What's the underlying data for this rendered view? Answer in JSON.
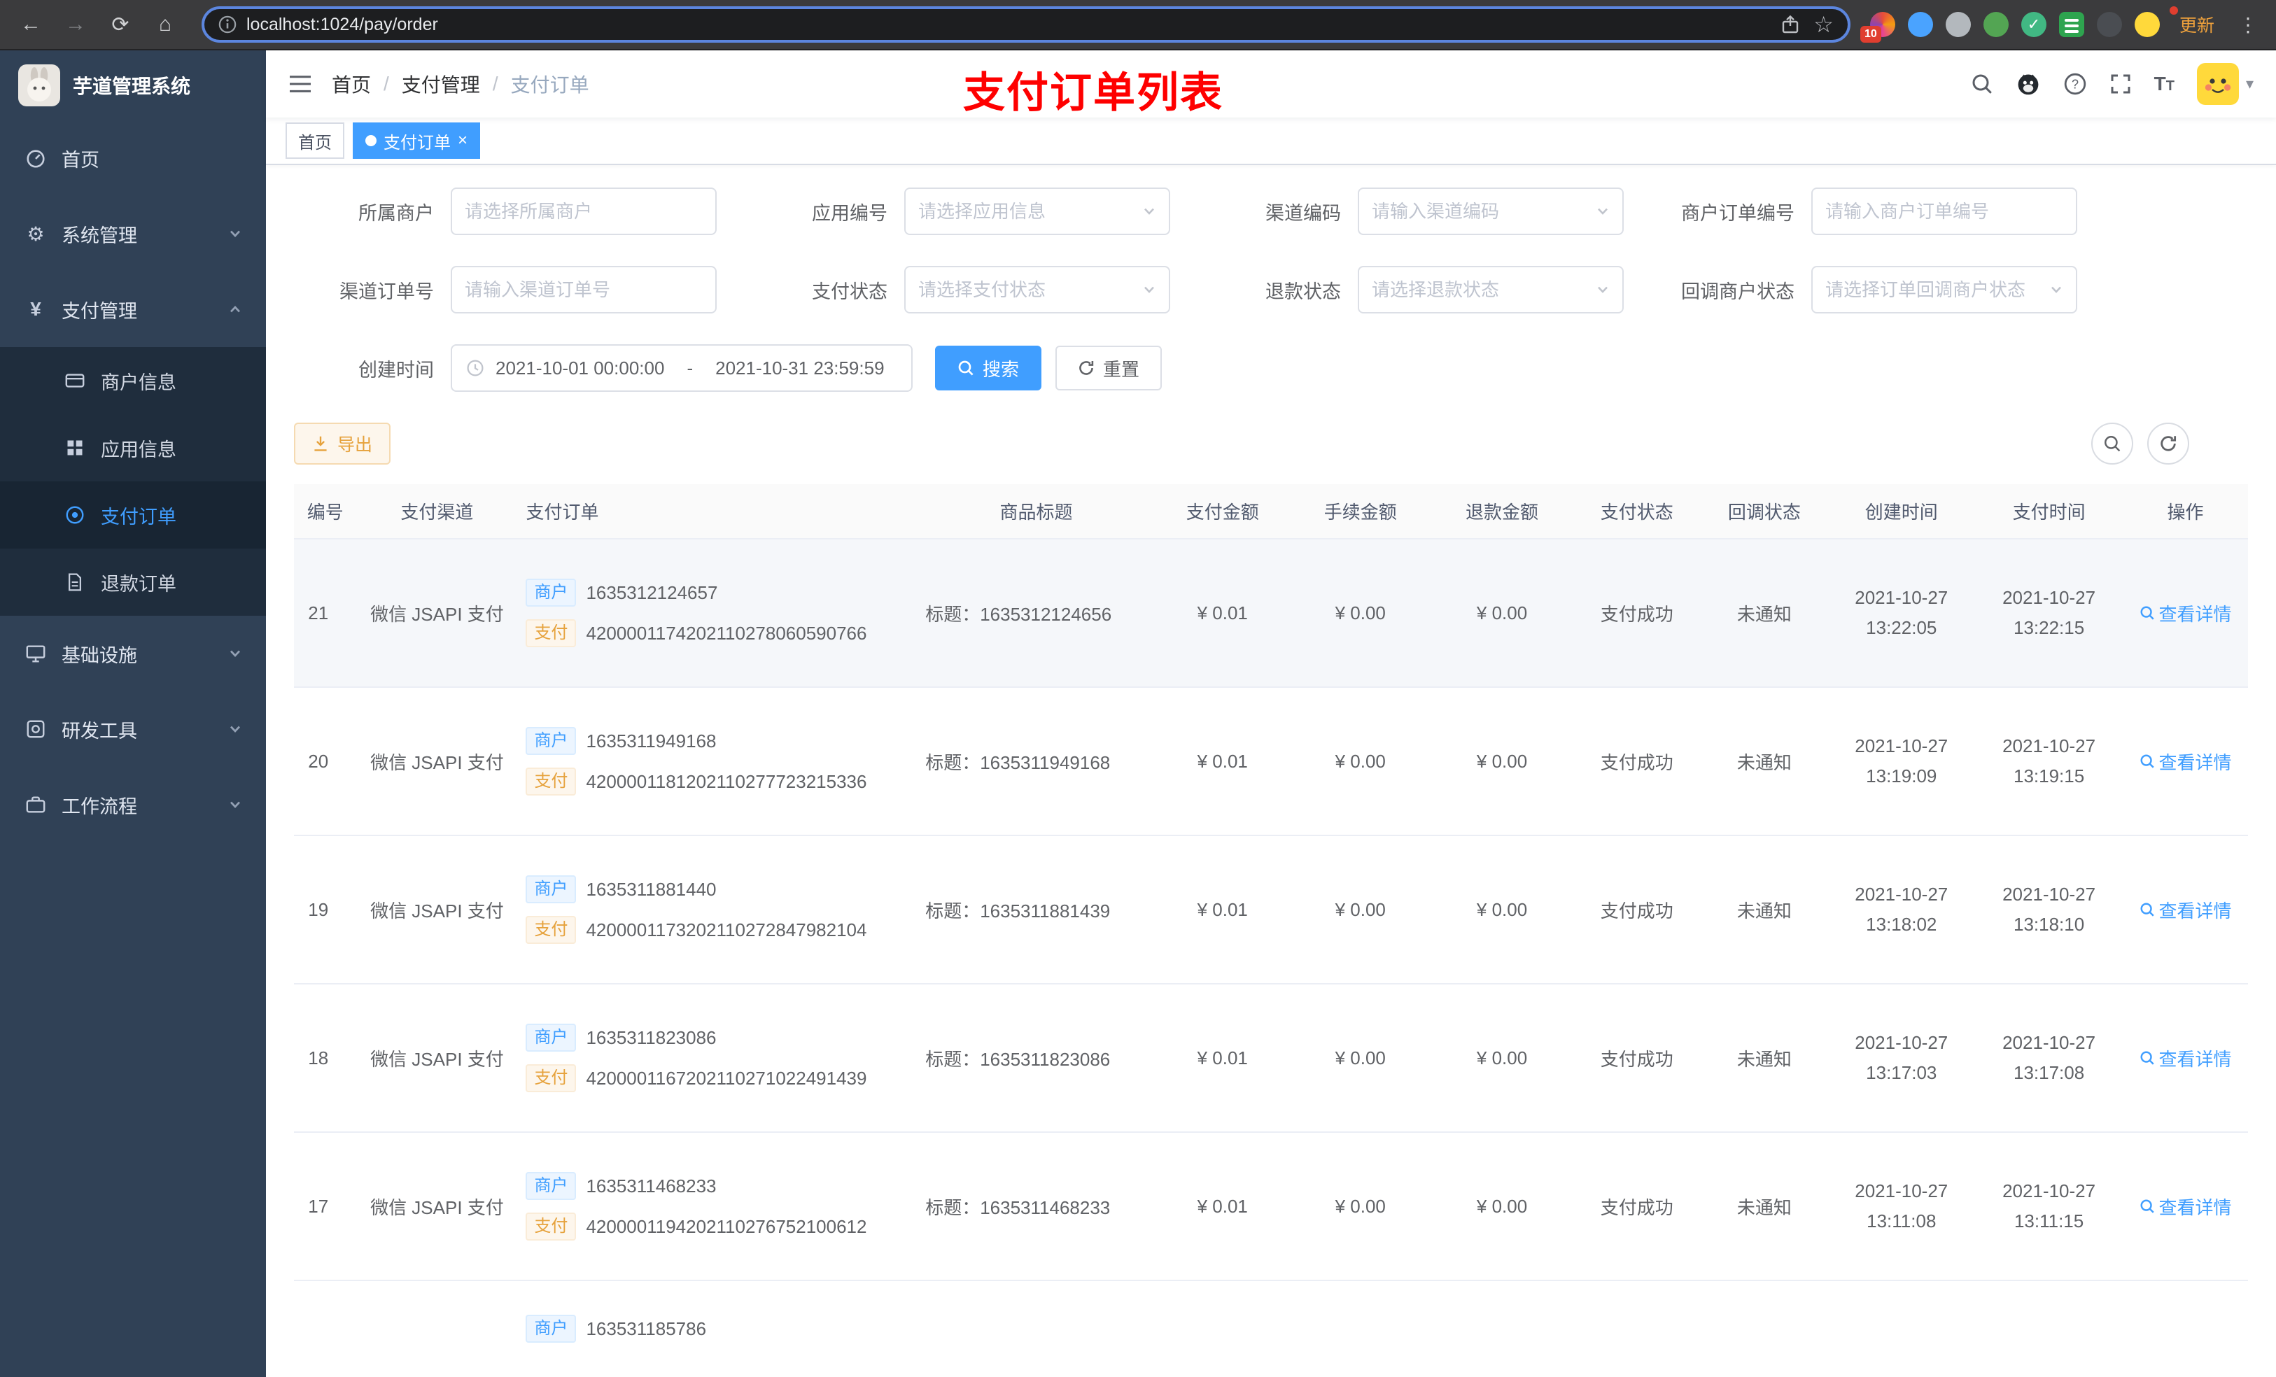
{
  "browser": {
    "url": "localhost:1024/pay/order",
    "update_label": "更新",
    "extension_badge": "10"
  },
  "icons": {
    "back": "←",
    "forward": "→",
    "reload": "⟳",
    "home": "⌂",
    "star": "☆",
    "kebab": "⋮",
    "gear": "⚙",
    "yen": "¥",
    "caret_down": "▾",
    "check": "✓",
    "question": "?"
  },
  "sidebar": {
    "logo_title": "芋道管理系统",
    "menu": [
      {
        "label": "首页"
      },
      {
        "label": "系统管理"
      },
      {
        "label": "支付管理"
      },
      {
        "label": "基础设施"
      },
      {
        "label": "研发工具"
      },
      {
        "label": "工作流程"
      }
    ],
    "submenu": [
      {
        "label": "商户信息"
      },
      {
        "label": "应用信息"
      },
      {
        "label": "支付订单"
      },
      {
        "label": "退款订单"
      }
    ]
  },
  "header": {
    "breadcrumb": [
      "首页",
      "支付管理",
      "支付订单"
    ],
    "separator": "/",
    "annotation": "支付订单列表"
  },
  "tags": {
    "home": "首页",
    "active": "支付订单",
    "close": "×"
  },
  "filters": {
    "fields": [
      {
        "label": "所属商户",
        "placeholder": "请选择所属商户"
      },
      {
        "label": "应用编号",
        "placeholder": "请选择应用信息"
      },
      {
        "label": "渠道编码",
        "placeholder": "请输入渠道编码"
      },
      {
        "label": "商户订单编号",
        "placeholder": "请输入商户订单编号"
      },
      {
        "label": "渠道订单号",
        "placeholder": "请输入渠道订单号"
      },
      {
        "label": "支付状态",
        "placeholder": "请选择支付状态"
      },
      {
        "label": "退款状态",
        "placeholder": "请选择退款状态"
      },
      {
        "label": "回调商户状态",
        "placeholder": "请选择订单回调商户状态"
      }
    ],
    "date_label": "创建时间",
    "date_start": "2021-10-01 00:00:00",
    "date_separator": "-",
    "date_end": "2021-10-31 23:59:59",
    "search_label": "搜索",
    "reset_label": "重置"
  },
  "toolbar": {
    "export_label": "导出"
  },
  "table": {
    "columns": [
      "编号",
      "支付渠道",
      "支付订单",
      "商品标题",
      "支付金额",
      "手续金额",
      "退款金额",
      "支付状态",
      "回调状态",
      "创建时间",
      "支付时间",
      "操作"
    ],
    "tag_merchant": "商户",
    "tag_pay": "支付",
    "title_prefix": "标题：",
    "action_label": "查看详情",
    "rows": [
      {
        "id": "21",
        "channel": "微信 JSAPI 支付",
        "merchant_no": "1635312124657",
        "pay_no": "4200001174202110278060590766",
        "title": "1635312124656",
        "amount": "¥ 0.01",
        "fee": "¥ 0.00",
        "refund": "¥ 0.00",
        "status": "支付成功",
        "notify": "未通知",
        "create_date": "2021-10-27",
        "create_time": "13:22:05",
        "pay_date": "2021-10-27",
        "pay_time": "13:22:15"
      },
      {
        "id": "20",
        "channel": "微信 JSAPI 支付",
        "merchant_no": "1635311949168",
        "pay_no": "4200001181202110277723215336",
        "title": "1635311949168",
        "amount": "¥ 0.01",
        "fee": "¥ 0.00",
        "refund": "¥ 0.00",
        "status": "支付成功",
        "notify": "未通知",
        "create_date": "2021-10-27",
        "create_time": "13:19:09",
        "pay_date": "2021-10-27",
        "pay_time": "13:19:15"
      },
      {
        "id": "19",
        "channel": "微信 JSAPI 支付",
        "merchant_no": "1635311881440",
        "pay_no": "4200001173202110272847982104",
        "title": "1635311881439",
        "amount": "¥ 0.01",
        "fee": "¥ 0.00",
        "refund": "¥ 0.00",
        "status": "支付成功",
        "notify": "未通知",
        "create_date": "2021-10-27",
        "create_time": "13:18:02",
        "pay_date": "2021-10-27",
        "pay_time": "13:18:10"
      },
      {
        "id": "18",
        "channel": "微信 JSAPI 支付",
        "merchant_no": "1635311823086",
        "pay_no": "4200001167202110271022491439",
        "title": "1635311823086",
        "amount": "¥ 0.01",
        "fee": "¥ 0.00",
        "refund": "¥ 0.00",
        "status": "支付成功",
        "notify": "未通知",
        "create_date": "2021-10-27",
        "create_time": "13:17:03",
        "pay_date": "2021-10-27",
        "pay_time": "13:17:08"
      },
      {
        "id": "17",
        "channel": "微信 JSAPI 支付",
        "merchant_no": "1635311468233",
        "pay_no": "4200001194202110276752100612",
        "title": "1635311468233",
        "amount": "¥ 0.01",
        "fee": "¥ 0.00",
        "refund": "¥ 0.00",
        "status": "支付成功",
        "notify": "未通知",
        "create_date": "2021-10-27",
        "create_time": "13:11:08",
        "pay_date": "2021-10-27",
        "pay_time": "13:11:15"
      }
    ],
    "partial_row": {
      "merchant_no": "163531185786"
    }
  }
}
